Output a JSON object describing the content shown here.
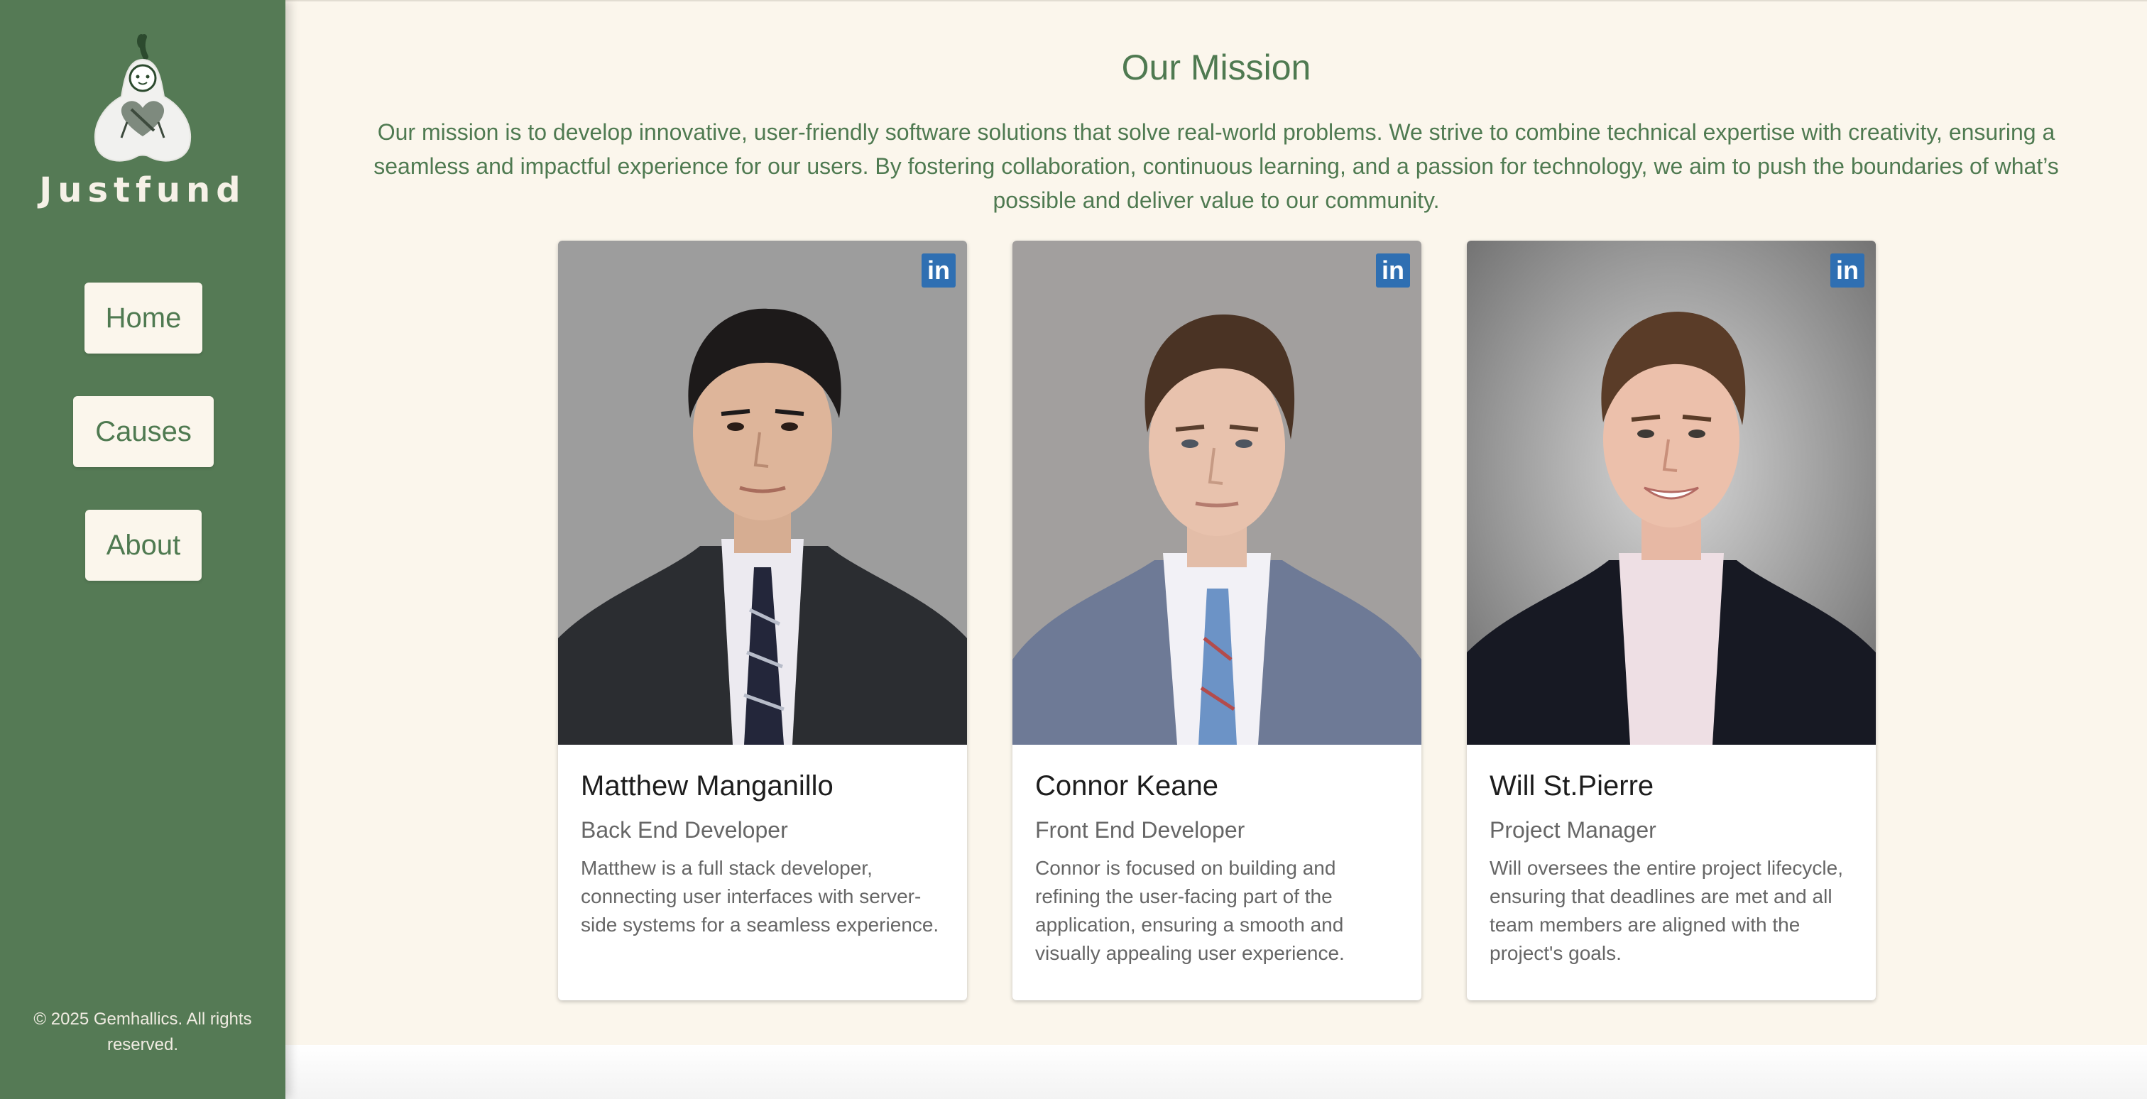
{
  "sidebar": {
    "brand": "Justfund",
    "logo_icon": "pear-character-heart-logo",
    "nav": [
      {
        "label": "Home"
      },
      {
        "label": "Causes"
      },
      {
        "label": "About"
      }
    ],
    "copyright": "© 2025 Gemhallics. All rights reserved."
  },
  "main": {
    "title": "Our Mission",
    "mission": "Our mission is to develop innovative, user-friendly software solutions that solve real-world problems. We strive to combine technical expertise with creativity, ensuring a seamless and impactful experience for our users. By fostering collaboration, continuous learning, and a passion for technology, we aim to push the boundaries of what’s possible and deliver value to our community.",
    "team": [
      {
        "name": "Matthew Manganillo",
        "role": "Back End Developer",
        "description": "Matthew is a full stack developer, connecting user interfaces with server-side systems for a seamless experience.",
        "linkedin_icon": "in"
      },
      {
        "name": "Connor Keane",
        "role": "Front End Developer",
        "description": "Connor is focused on building and refining the user-facing part of the application, ensuring a smooth and visually appealing user experience.",
        "linkedin_icon": "in"
      },
      {
        "name": "Will St.Pierre",
        "role": "Project Manager",
        "description": "Will oversees the entire project lifecycle, ensuring that deadlines are met and all team members are aligned with the project's goals.",
        "linkedin_icon": "in"
      }
    ]
  },
  "colors": {
    "sidebar": "#557a55",
    "background": "#fbf6ec",
    "accent_text": "#4f7a51",
    "linkedin": "#2f6fb2"
  }
}
